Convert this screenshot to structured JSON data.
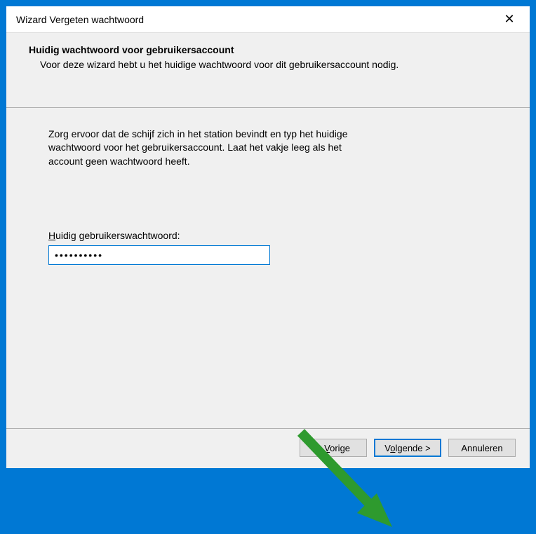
{
  "titlebar": {
    "title": "Wizard Vergeten wachtwoord"
  },
  "header": {
    "title": "Huidig wachtwoord voor gebruikersaccount",
    "subtitle": "Voor deze wizard hebt u het huidige wachtwoord voor dit gebruikersaccount nodig."
  },
  "content": {
    "instruction": "Zorg ervoor dat de schijf zich in het station bevindt en typ het huidige wachtwoord voor het gebruikersaccount. Laat het vakje leeg als het account geen wachtwoord heeft.",
    "password_label_prefix": "H",
    "password_label_rest": "uidig gebruikerswachtwoord:",
    "password_value": "••••••••••"
  },
  "footer": {
    "back_prefix": "< ",
    "back_u": "V",
    "back_rest": "orige",
    "next_prefix": "V",
    "next_u": "o",
    "next_rest": "lgende >",
    "cancel": "Annuleren"
  }
}
